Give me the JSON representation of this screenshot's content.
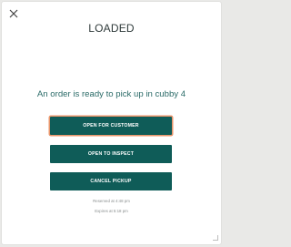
{
  "dialog": {
    "title": "LOADED",
    "message": "An order is ready to pick up in cubby 4",
    "buttons": {
      "open_for_customer": "OPEN FOR CUSTOMER",
      "open_to_inspect": "OPEN TO INSPECT",
      "cancel_pickup": "CANCEL PICKUP"
    },
    "reserved_text": "Reserved at 4:48 pm",
    "expires_text": "Expires at 5:18 pm"
  },
  "colors": {
    "accent": "#0f5c58",
    "focus_ring": "#e8956b",
    "message_text": "#2b6b68"
  },
  "icons": {
    "close": "close-icon"
  }
}
